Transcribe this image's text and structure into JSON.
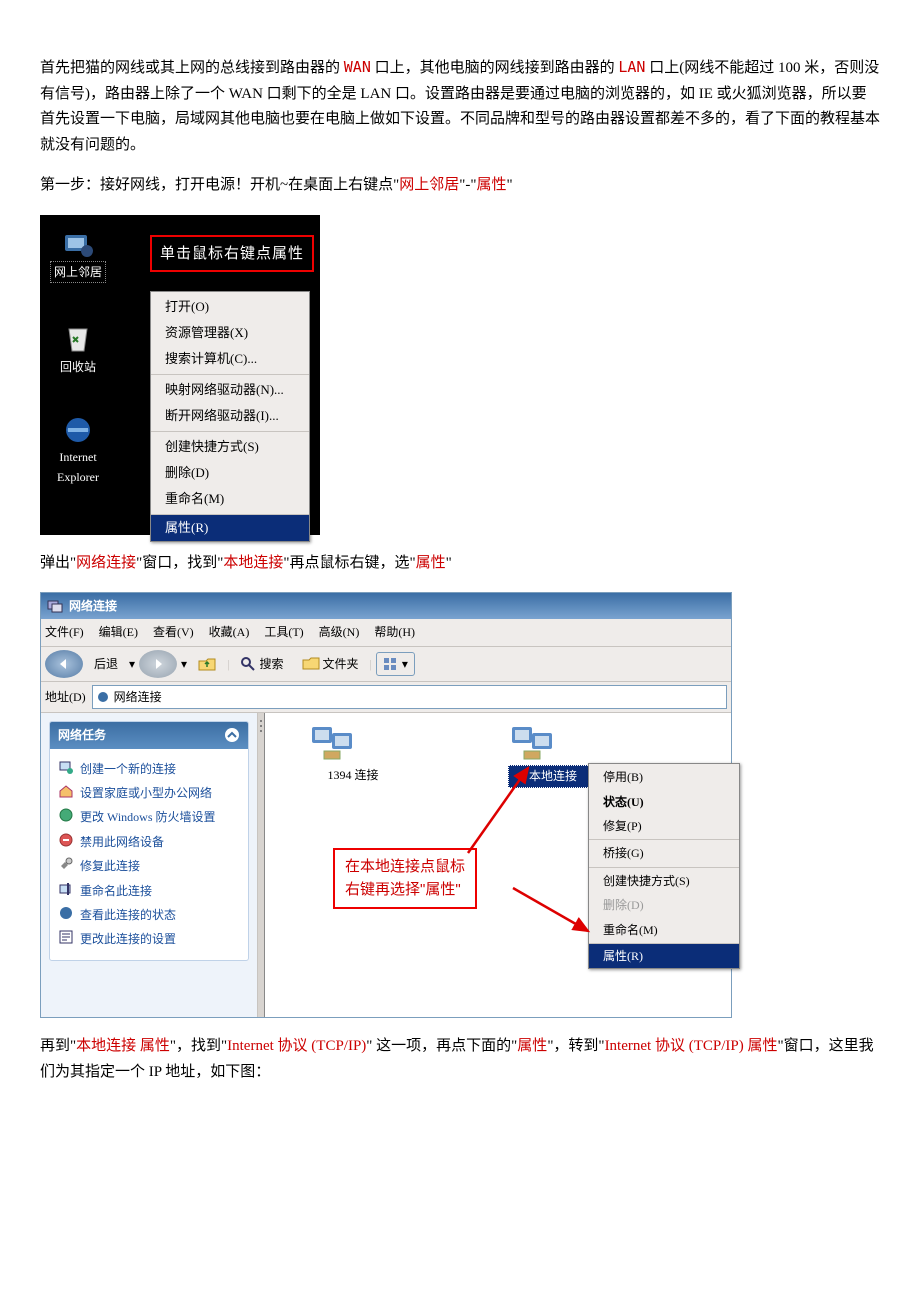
{
  "p1": {
    "a": "首先把猫的网线或其上网的总线接到路由器的 ",
    "wan": "WAN",
    "b": " 口上，其他电脑的网线接到路由器的 ",
    "lan": "LAN",
    "c": " 口上(网线不能超过 100 米，否则没有信号)，路由器上除了一个 WAN 口剩下的全是 LAN 口。设置路由器是要通过电脑的浏览器的，如 IE 或火狐浏览器，所以要首先设置一下电脑，局域网其他电脑也要在电脑上做如下设置。不同品牌和型号的路由器设置都差不多的，看了下面的教程基本就没有问题的。"
  },
  "p2": {
    "a": "第一步：接好网线，打开电源！开机~在桌面上右键点\"",
    "net": "网上邻居",
    "b": "\"-\"",
    "prop": "属性",
    "c": "\""
  },
  "shot1": {
    "tip": "单击鼠标右键点属性",
    "icons": {
      "net": "网上邻居",
      "bin": "回收站",
      "ie": "Internet Explorer"
    },
    "menu": {
      "open": "打开(O)",
      "explorer": "资源管理器(X)",
      "search": "搜索计算机(C)...",
      "map": "映射网络驱动器(N)...",
      "unmap": "断开网络驱动器(I)...",
      "shortcut": "创建快捷方式(S)",
      "delete": "删除(D)",
      "rename": "重命名(M)",
      "prop": "属性(R)"
    }
  },
  "p3": {
    "a": "弹出\"",
    "netconn": "网络连接",
    "b": "\"窗口，找到\"",
    "local": "本地连接",
    "c": "\"再点鼠标右键，选\"",
    "prop": "属性",
    "d": "\""
  },
  "shot2": {
    "title": "网络连接",
    "menu": {
      "file": "文件(F)",
      "edit": "编辑(E)",
      "view": "查看(V)",
      "fav": "收藏(A)",
      "tool": "工具(T)",
      "adv": "高级(N)",
      "help": "帮助(H)"
    },
    "toolbar": {
      "back": "后退",
      "search": "搜索",
      "folders": "文件夹"
    },
    "addr": {
      "label": "地址(D)",
      "value": "网络连接"
    },
    "panel": {
      "title": "网络任务",
      "tasks": {
        "new": "创建一个新的连接",
        "home": "设置家庭或小型办公网络",
        "fw": "更改 Windows 防火墙设置",
        "disable": "禁用此网络设备",
        "repair": "修复此连接",
        "rename": "重命名此连接",
        "status": "查看此连接的状态",
        "change": "更改此连接的设置"
      }
    },
    "items": {
      "conn1394": "1394 连接",
      "local": "本地连接"
    },
    "ctx": {
      "disable": "停用(B)",
      "status": "状态(U)",
      "repair": "修复(P)",
      "bridge": "桥接(G)",
      "shortcut": "创建快捷方式(S)",
      "delete": "删除(D)",
      "rename": "重命名(M)",
      "prop": "属性(R)"
    },
    "tip": {
      "l1": "在本地连接点鼠标",
      "l2": "右键再选择\"属性\""
    }
  },
  "p4": {
    "a": "再到\"",
    "localprop": "本地连接 属性",
    "b": "\"，找到\"",
    "tcp": "Internet 协议 (TCP/IP)",
    "c": "\"  这一项，再点下面的\"",
    "prop": "属性",
    "d": "\"，转到\"",
    "tcpprop": "Internet 协议 (TCP/IP) 属性",
    "e": "\"窗口，这里我们为其指定一个 IP 地址，如下图："
  }
}
